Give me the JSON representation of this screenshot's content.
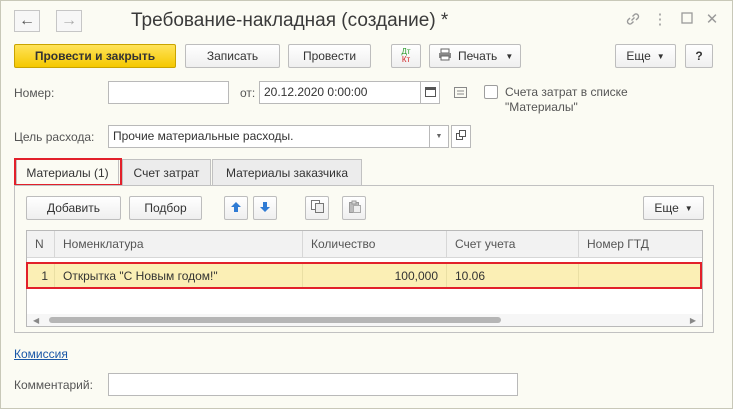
{
  "window": {
    "title": "Требование-накладная (создание) *",
    "back_icon": "arrow-left-icon",
    "forward_icon": "arrow-right-icon",
    "link_icon": "link-icon",
    "more_icon": "more-vertical-icon",
    "maximize_icon": "maximize-icon",
    "close_icon": "close-icon"
  },
  "toolbar": {
    "post_close_label": "Провести и закрыть",
    "save_label": "Записать",
    "post_label": "Провести",
    "dt_label": "Дт",
    "kt_label": "Кт",
    "print_label": "Печать",
    "more_label": "Еще",
    "help_label": "?"
  },
  "header": {
    "number_label": "Номер:",
    "number_value": "",
    "from_label": "от:",
    "date_value": "20.12.2020  0:00:00",
    "cost_accounts_label_line1": "Счета затрат в списке",
    "cost_accounts_label_line2": "\"Материалы\"",
    "cost_accounts_checked": false,
    "purpose_label": "Цель расхода:",
    "purpose_value": "Прочие материальные расходы."
  },
  "tabs": [
    {
      "label": "Материалы (1)",
      "active": true
    },
    {
      "label": "Счет затрат",
      "active": false
    },
    {
      "label": "Материалы заказчика",
      "active": false
    }
  ],
  "materials": {
    "add_label": "Добавить",
    "select_label": "Подбор",
    "more_label": "Еще",
    "columns": [
      "N",
      "Номенклатура",
      "Количество",
      "Счет учета",
      "Номер ГТД"
    ],
    "rows": [
      {
        "n": "1",
        "item": "Открытка \"С Новым годом!\"",
        "quantity": "100,000",
        "account": "10.06",
        "gtd": ""
      }
    ]
  },
  "footer": {
    "commission_link": "Комиссия",
    "comment_label": "Комментарий:",
    "comment_value": ""
  },
  "colors": {
    "accent_yellow": "#f5c800",
    "highlight_red": "#e2202a",
    "selected_row": "#fbefb5",
    "link_blue": "#1a57a7",
    "arrow_blue": "#2f7bd4"
  }
}
